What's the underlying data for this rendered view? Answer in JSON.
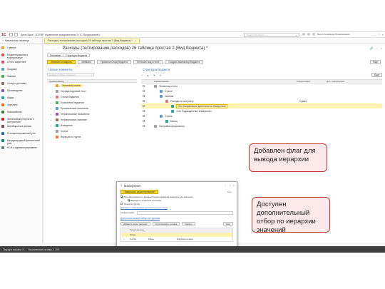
{
  "window": {
    "title": "Демо база / 1С:ERP Управление предприятием 2  (1С:Предприятие)",
    "search_placeholder": "Поиск Ctrl+Shift+F",
    "user": "Белов Александр Владимирович"
  },
  "tabs": {
    "home": "Начальная страница",
    "document": "Расходы (тестирование расходов) 26 таблица простая 2 (Вид бюджета) *"
  },
  "sidebar": {
    "items": [
      {
        "label": "Главное",
        "color": "#e8a33a"
      },
      {
        "label": "Бюджетирование и планирование",
        "color": "#d9534f"
      },
      {
        "label": "CRM и маркетинг",
        "color": "#e24a7d"
      },
      {
        "label": "Продажи",
        "color": "#5b9bd5"
      },
      {
        "label": "Закупки",
        "color": "#4caf50"
      },
      {
        "label": "Склад и доставка",
        "color": "#8d6e63"
      },
      {
        "label": "Производство",
        "color": "#7e57c2"
      },
      {
        "label": "Кадры",
        "color": "#26a69a"
      },
      {
        "label": "Зарплата",
        "color": "#ef6c00"
      },
      {
        "label": "Казначейство",
        "color": "#2e7d32"
      },
      {
        "label": "Финансовый результат и контроллинг",
        "color": "#c62828"
      },
      {
        "label": "Внеоборотные активы",
        "color": "#6d4c41"
      },
      {
        "label": "Регламентированный учет",
        "color": "#1565c0"
      },
      {
        "label": "Международный финансовый учет",
        "color": "#00897b"
      },
      {
        "label": "НСИ и администрирование",
        "color": "#607d8b"
      }
    ]
  },
  "main": {
    "title": "Расходы (тестирование расходов) 26 таблица простая 2 (Вид бюджета) *",
    "subtabs": [
      "Основное",
      "Структура бюджета"
    ],
    "toolbar": {
      "save_close": "Записать и закрыть",
      "write": "Записать",
      "apply_view": "Применить вид бюджета",
      "print_view": "Печатать вид отчета",
      "create_copy": "Создать экземпляр бюджета",
      "more": "Еще"
    },
    "left_title": "Новые элементы",
    "right_title": "Структура бюджета",
    "left_search": "Добавить новые элементы",
    "left_list_header": "Наименование",
    "elements": [
      {
        "label": "Заголовок отчета",
        "selected": true,
        "color": "#f0a030"
      },
      {
        "label": "Нередактируемый текст",
        "selected": false,
        "color": "#9e9e9e"
      },
      {
        "label": "Статья бюджетов",
        "selected": false,
        "color": "#e57373"
      },
      {
        "label": "Показатели бюджетов",
        "selected": false,
        "color": "#4caf50"
      },
      {
        "label": "Произвольный показатель",
        "selected": false,
        "color": "#5b9bd5"
      },
      {
        "label": "Нефинансовые показатели",
        "selected": false,
        "color": "#ab47bc"
      },
      {
        "label": "Нефинансовое значение",
        "selected": false,
        "color": "#8d6e63"
      },
      {
        "label": "Измерения",
        "selected": false,
        "color": "#26a69a"
      },
      {
        "label": "Группа",
        "selected": false,
        "color": "#9e9e9e"
      },
      {
        "label": "Формула по группе",
        "selected": false,
        "color": "#ff7043"
      }
    ],
    "right_more": "Еще",
    "right_columns": [
      "Наименование",
      "Комментарий",
      "Доп. информация"
    ],
    "tree": [
      {
        "label": "Элементы отчета",
        "indent": 0,
        "comment": "",
        "selected": false,
        "color": "#9e9e9e"
      },
      {
        "label": "Строки",
        "indent": 1,
        "comment": "",
        "selected": false,
        "color": "#5b9bd5"
      },
      {
        "label": "Колонки",
        "indent": 1,
        "comment": "",
        "selected": false,
        "color": "#5b9bd5"
      },
      {
        "label": "Расходы по контракту",
        "indent": 2,
        "comment": "Сумма",
        "selected": false,
        "color": "#e57373"
      },
      {
        "label": "<Кто Направление деятельности Измерение>",
        "indent": 3,
        "comment": "",
        "selected": true,
        "color": "#26a69a"
      },
      {
        "label": "<Кто Подразделение Измерение>",
        "indent": 3,
        "comment": "",
        "selected": false,
        "color": "#26a69a"
      },
      {
        "label": "Строки",
        "indent": 1,
        "comment": "",
        "selected": false,
        "color": "#5b9bd5"
      },
      {
        "label": "Месяц",
        "indent": 2,
        "comment": "",
        "selected": false,
        "color": "#26a69a"
      },
      {
        "label": "Настройки оформления",
        "indent": 0,
        "comment": "",
        "selected": false,
        "color": "#9e9e9e"
      }
    ]
  },
  "dialog": {
    "title": "Измерение",
    "apply_button": "Завершить редактирование",
    "help_link": "Еще",
    "checkboxes": [
      {
        "label": "При заполнении по данным бюджетирования выводить все значения",
        "checked": true
      },
      {
        "label": "Выводить иерархию значений",
        "checked": true
      },
      {
        "label": "Итоги по группе",
        "checked": false
      }
    ],
    "formatting_link": "Настроить оформление дополнительных строк",
    "comment_label": "Комментарий:",
    "filter_section": "Дополнительный отбор по группам",
    "filter_toolbar": [
      "Добавить новое значение",
      "Сгруппировать условия",
      "Удалить",
      "Еще"
    ],
    "table_header": "Представление",
    "rows": [
      {
        "c0": "",
        "c1": "Отбор",
        "c2": "",
        "c3": "",
        "hl": true
      },
      {
        "c0": "✓",
        "c1": "Группа",
        "c2": "Равно",
        "c3": "Индукция Сервис",
        "hl": false
      }
    ]
  },
  "callouts": {
    "first": "Добавлен флаг для вывода иерархии",
    "second": "Доступен дополнительный отбор по иерархии значений"
  },
  "status": {
    "calls": "Текущие вызовы: 8",
    "accumulated": "Накопленные вызовы: 1 109"
  }
}
